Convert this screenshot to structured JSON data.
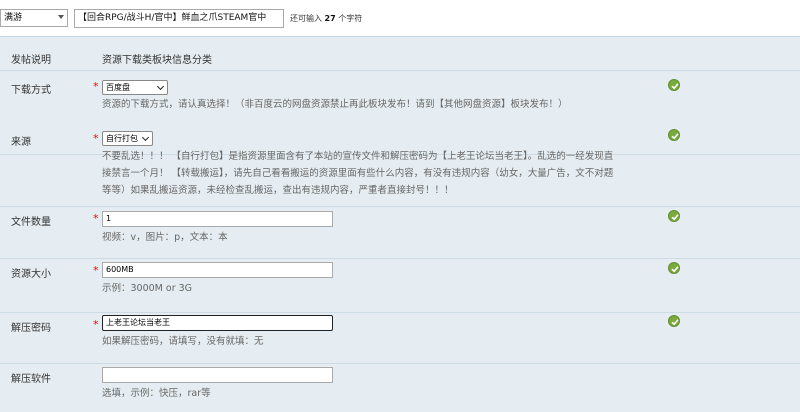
{
  "topbar": {
    "category_value": "满游",
    "title_value": "【回合RPG/战斗H/官中】鲜血之爪STEAM官中",
    "char_hint_prefix": "还可输入",
    "char_hint_count": "27",
    "char_hint_suffix": "个字符"
  },
  "form": {
    "post_desc": {
      "label": "发帖说明",
      "value": "资源下载类板块信息分类"
    },
    "download": {
      "label": "下载方式",
      "selected": "百度盘",
      "hint": "资源的下载方式，请认真选择！（非百度云的网盘资源禁止再此板块发布！请到【其他网盘资源】板块发布！）"
    },
    "source": {
      "label": "来源",
      "selected": "自行打包",
      "hint_lines": [
        "不要乱选！！！ 【自行打包】是指资源里面含有了本站的宣传文件和解压密码为【上老王论坛当老王】。乱选的一经发现直",
        "接禁言一个月！ 【转载搬运】，请先自己看看搬运的资源里面有些什么内容，有没有违规内容（幼女，大量广告，文不对题",
        "等等）如果乱搬运资源，未经检查乱搬运，查出有违规内容，严重者直接封号！！！"
      ]
    },
    "file_count": {
      "label": "文件数量",
      "value": "1",
      "hint": "视频：v，图片：p，文本：本"
    },
    "size": {
      "label": "资源大小",
      "value": "600MB",
      "hint": "示例：3000M or 3G"
    },
    "password": {
      "label": "解压密码",
      "value": "上老王论坛当老王",
      "hint": "如果解压密码，请填写，没有就填：无"
    },
    "software": {
      "label": "解压软件",
      "value": "",
      "hint": "选填，示例：快压，rar等"
    }
  },
  "icons": {
    "valid": "check-circle-icon"
  },
  "colors": {
    "form_bg": "#e5edf2",
    "required": "#ff0000",
    "valid": "#7aaa3d"
  }
}
